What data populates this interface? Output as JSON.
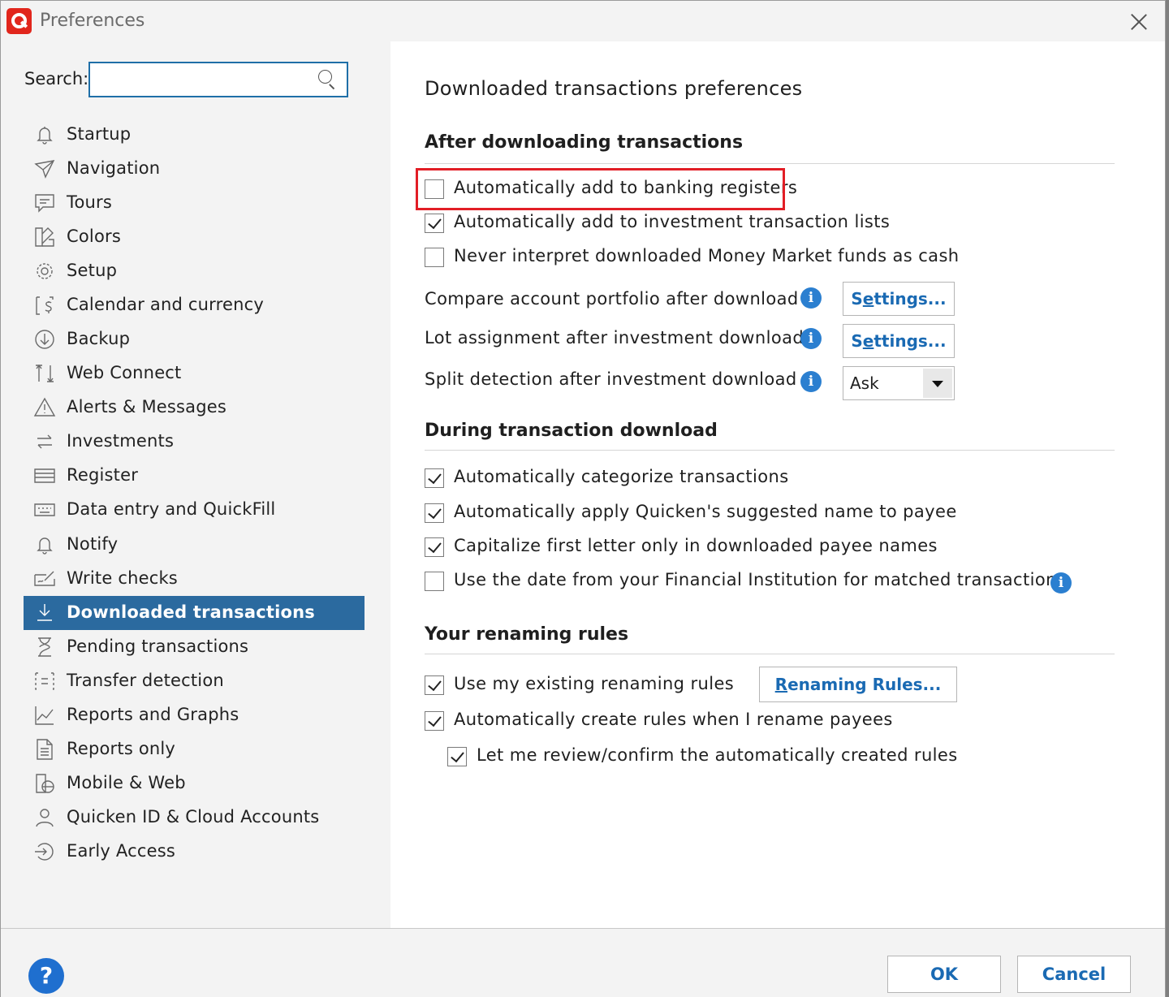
{
  "window": {
    "title": "Preferences",
    "close_icon": "close-icon",
    "logo_icon": "quicken-logo-icon"
  },
  "search": {
    "label": "Search:",
    "value": "",
    "placeholder": ""
  },
  "nav": {
    "items": [
      {
        "label": "Startup",
        "icon": "bell-icon"
      },
      {
        "label": "Navigation",
        "icon": "paper-plane-icon"
      },
      {
        "label": "Tours",
        "icon": "speech-bubble-icon"
      },
      {
        "label": "Colors",
        "icon": "palette-icon"
      },
      {
        "label": "Setup",
        "icon": "gear-icon"
      },
      {
        "label": "Calendar and currency",
        "icon": "calendar-dollar-icon"
      },
      {
        "label": "Backup",
        "icon": "download-circle-icon"
      },
      {
        "label": "Web Connect",
        "icon": "up-down-arrows-icon"
      },
      {
        "label": "Alerts & Messages",
        "icon": "warning-icon"
      },
      {
        "label": "Investments",
        "icon": "swap-arrows-icon"
      },
      {
        "label": "Register",
        "icon": "register-icon"
      },
      {
        "label": "Data entry and QuickFill",
        "icon": "keyboard-icon"
      },
      {
        "label": "Notify",
        "icon": "bell-icon"
      },
      {
        "label": "Write checks",
        "icon": "check-write-icon"
      },
      {
        "label": "Downloaded transactions",
        "icon": "download-arrow-icon",
        "selected": true
      },
      {
        "label": "Pending transactions",
        "icon": "hourglass-icon"
      },
      {
        "label": "Transfer detection",
        "icon": "transfer-icon"
      },
      {
        "label": "Reports and Graphs",
        "icon": "line-chart-icon"
      },
      {
        "label": "Reports only",
        "icon": "document-icon"
      },
      {
        "label": "Mobile & Web",
        "icon": "mobile-web-icon"
      },
      {
        "label": "Quicken ID & Cloud Accounts",
        "icon": "user-icon"
      },
      {
        "label": "Early Access",
        "icon": "early-access-icon"
      }
    ]
  },
  "main": {
    "title": "Downloaded transactions preferences",
    "after_section": {
      "title": "After downloading transactions",
      "checks": [
        {
          "label": "Automatically add to banking registers",
          "checked": false
        },
        {
          "label": "Automatically add to investment transaction lists",
          "checked": true
        },
        {
          "label": "Never interpret downloaded Money Market funds as cash",
          "checked": false
        }
      ],
      "compare_label": "Compare account portfolio after download",
      "lot_label": "Lot assignment after investment download",
      "split_label": "Split detection after investment download",
      "settings_label_pre": "S",
      "settings_label_u": "e",
      "settings_label_post": "ttings...",
      "split_value": "Ask"
    },
    "during_section": {
      "title": "During transaction download",
      "checks": [
        {
          "label": "Automatically categorize transactions",
          "checked": true
        },
        {
          "label": "Automatically apply Quicken's suggested name to payee",
          "checked": true
        },
        {
          "label": "Capitalize first letter only in downloaded payee names",
          "checked": true
        },
        {
          "label": "Use the date from your Financial Institution for matched transactions",
          "checked": false
        }
      ]
    },
    "renaming_section": {
      "title": "Your renaming rules",
      "checks": [
        {
          "label": "Use my existing renaming rules",
          "checked": true
        },
        {
          "label": "Automatically create rules when I rename payees",
          "checked": true
        },
        {
          "label": "Let me review/confirm the automatically created rules",
          "checked": true
        }
      ],
      "rules_button_u": "R",
      "rules_button_post": "enaming Rules..."
    },
    "info_glyph": "i"
  },
  "footer": {
    "help": "?",
    "ok": "OK",
    "cancel": "Cancel"
  },
  "colors": {
    "accent": "#2b6a9f",
    "highlight": "#e21e26",
    "link": "#1a6ab3",
    "info": "#2b7fd0"
  }
}
